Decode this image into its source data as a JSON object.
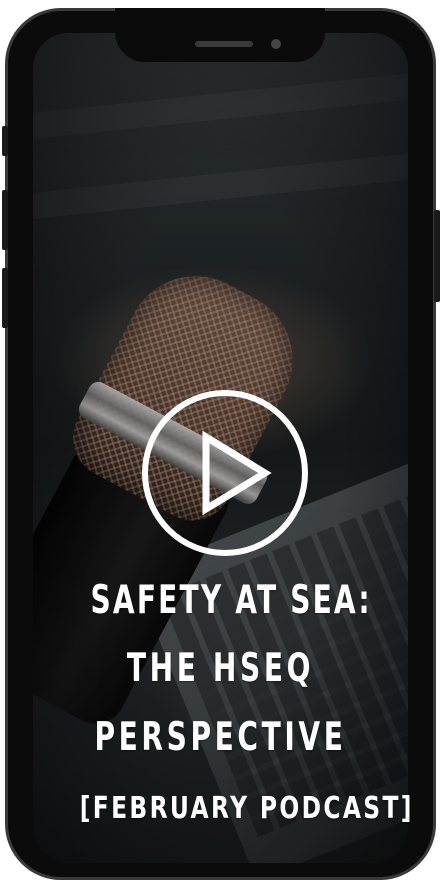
{
  "hero": {
    "title_lines": [
      "SAFETY AT SEA:",
      "THE HSEQ",
      "PERSPECTIVE"
    ],
    "subtitle": "[FEBRUARY PODCAST]",
    "background": "podcast microphone with laptop keyboard, darkened photo"
  },
  "player": {
    "play_icon": "play-icon"
  },
  "device": {
    "frame_color": "#0b0b0b",
    "text_color": "#ffffff"
  }
}
